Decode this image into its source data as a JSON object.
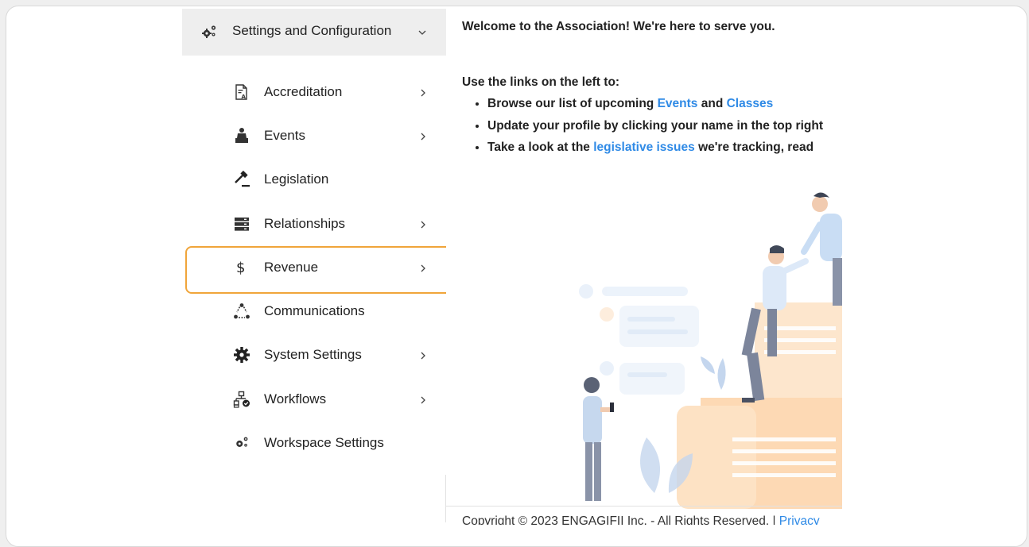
{
  "sidebar": {
    "header": {
      "label": "Settings and Configuration",
      "icon": "gears-icon"
    },
    "items": [
      {
        "label": "Accreditation",
        "icon": "certificate-icon",
        "has_chevron": true
      },
      {
        "label": "Events",
        "icon": "presenter-icon",
        "has_chevron": true
      },
      {
        "label": "Legislation",
        "icon": "gavel-icon",
        "has_chevron": false
      },
      {
        "label": "Relationships",
        "icon": "server-icon",
        "has_chevron": true
      },
      {
        "label": "Revenue",
        "icon": "dollar-icon",
        "has_chevron": true,
        "highlighted": true
      },
      {
        "label": "Communications",
        "icon": "network-icon",
        "has_chevron": false
      },
      {
        "label": "System Settings",
        "icon": "gear-icon",
        "has_chevron": true
      },
      {
        "label": "Workflows",
        "icon": "sitemap-icon",
        "has_chevron": true
      },
      {
        "label": "Workspace Settings",
        "icon": "gears-icon",
        "has_chevron": false
      }
    ]
  },
  "content": {
    "welcome": "Welcome to the Association!  We're here to serve you.",
    "intro": "Use the links on the left to:",
    "bullets": {
      "b1": {
        "pre": "Browse our list of upcoming ",
        "link1": "Events",
        "mid": " and ",
        "link2": "Classes"
      },
      "b2": {
        "text": "Update your profile by clicking your name in the top right"
      },
      "b3": {
        "pre": "Take a look at the ",
        "link": "legislative issues",
        "post": " we're tracking, read"
      }
    },
    "footer": {
      "text": "Copyright © 2023 ENGAGIFII Inc. - All Rights Reserved. | ",
      "link": "Privacy"
    }
  },
  "colors": {
    "accent": "#f0a53a",
    "link": "#2f8ae6",
    "header_bg": "#eeeeee"
  }
}
